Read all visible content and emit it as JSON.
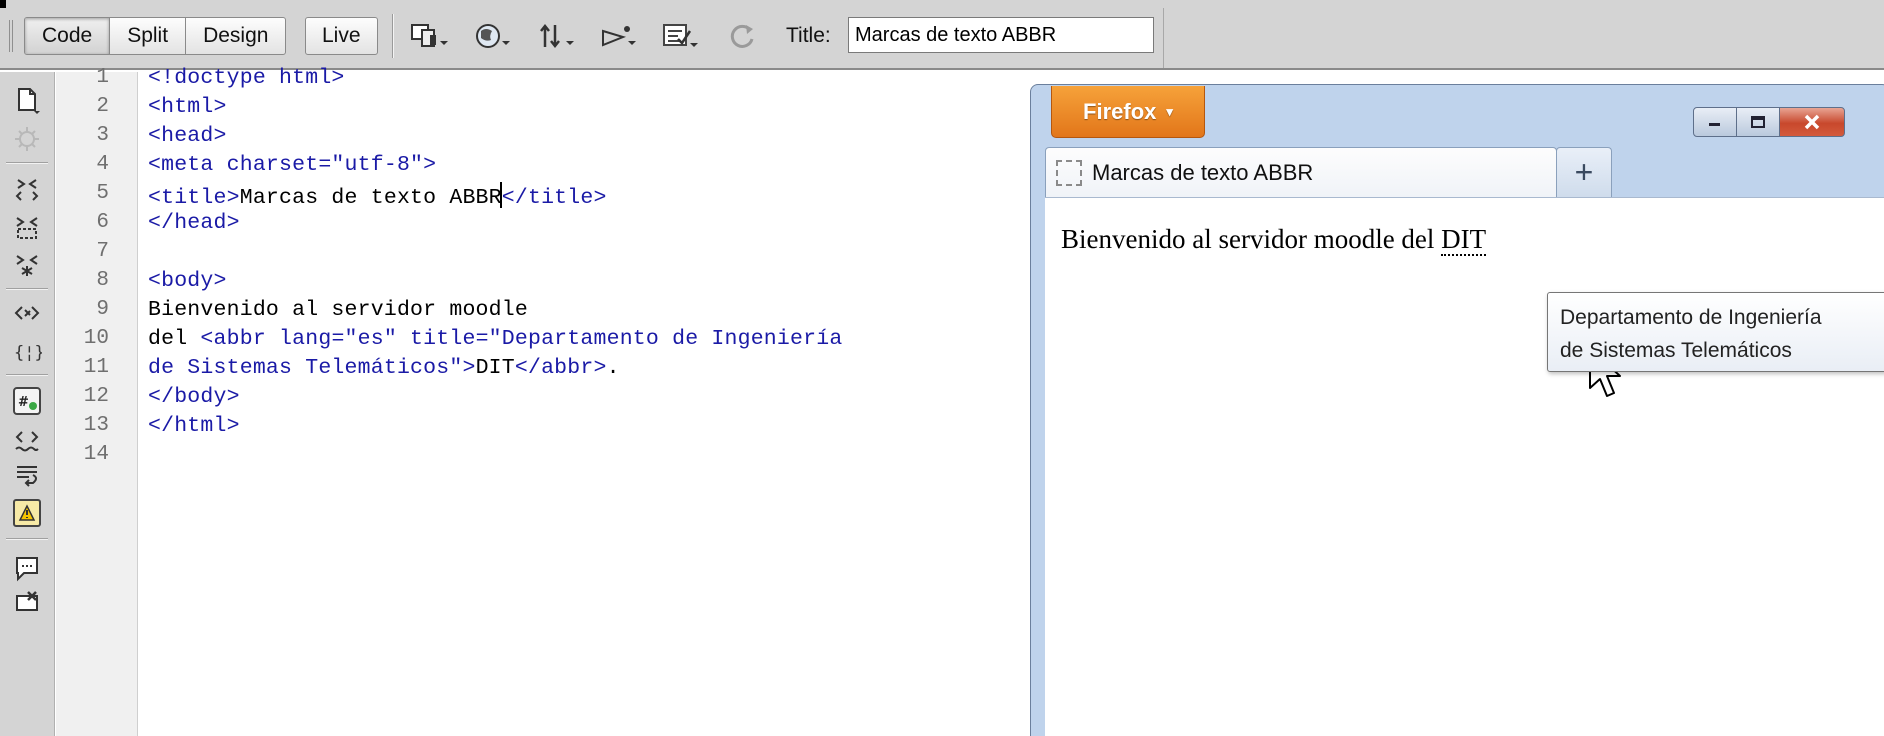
{
  "toolbar": {
    "views": [
      {
        "label": "Code",
        "active": true
      },
      {
        "label": "Split",
        "active": false
      },
      {
        "label": "Design",
        "active": false
      }
    ],
    "live_label": "Live",
    "icons": [
      "multiscreen-icon",
      "browser-preview-icon",
      "file-management-icon",
      "visual-aids-icon",
      "validate-markup-icon",
      "refresh-icon"
    ],
    "title_label": "Title:",
    "title_value": "Marcas de texto ABBR"
  },
  "sidebar": {
    "icons": [
      "open-documents-icon",
      "show-code-navigator-icon",
      "collapse-full-tag-icon",
      "collapse-selection-icon",
      "expand-all-icon",
      "select-parent-tag-icon",
      "balance-braces-icon",
      "line-numbers-icon",
      "highlight-invalid-code-icon",
      "syntax-coloring-icon",
      "word-wrap-icon",
      "apply-comment-icon",
      "remove-comment-icon"
    ]
  },
  "editor": {
    "line_numbers": [
      "1",
      "2",
      "3",
      "4",
      "5",
      "6",
      "7",
      "8",
      "9",
      "10",
      "11",
      "12",
      "13",
      "14"
    ],
    "lines": [
      "<!doctype html>",
      "<html>",
      "<head>",
      "<meta charset=\"utf-8\">",
      "<title>Marcas de texto ABBR</title>",
      "</head>",
      "",
      "<body>",
      "Bienvenido al servidor moodle",
      "del <abbr lang=\"es\" title=\"Departamento de Ingeniería",
      "de Sistemas Telemáticos\">DIT</abbr>.",
      "</body>",
      "</html>",
      ""
    ]
  },
  "browser": {
    "menu_label": "Firefox",
    "menu_arrow": "▾",
    "tab_label": "Marcas de texto ABBR",
    "new_tab_label": "+",
    "page_text": "Bienvenido al servidor moodle del ",
    "abbr_text": "DIT",
    "tooltip_line1": "Departamento de Ingeniería",
    "tooltip_line2": "de Sistemas Telemáticos"
  }
}
